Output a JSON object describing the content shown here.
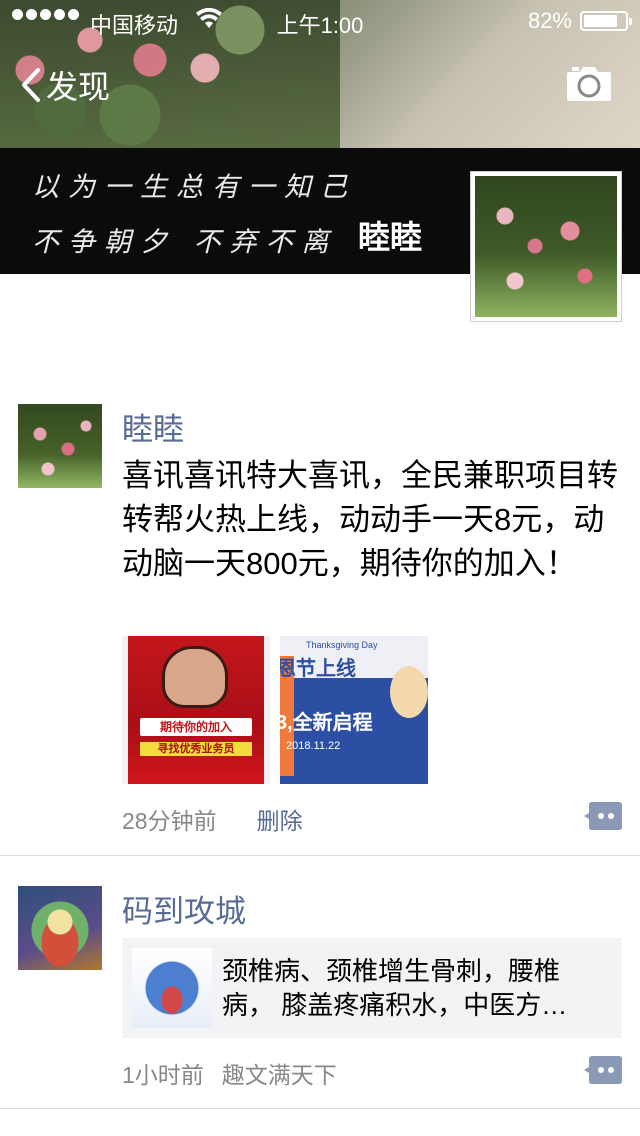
{
  "status_bar": {
    "carrier": "中国移动",
    "time": "上午1:00",
    "battery_pct": "82%",
    "battery_level": 0.82
  },
  "nav": {
    "back_label": "发现",
    "back_icon": "chevron-left-icon",
    "camera_icon": "camera-icon"
  },
  "cover": {
    "poem_line1": "以为一生总有一知己",
    "poem_line2": "不争朝夕 不弃不离",
    "user_name": "睦睦"
  },
  "posts": [
    {
      "name": "睦睦",
      "text": "喜讯喜讯特大喜讯，全民兼职项目转转帮火热上线，动动手一天8元，动动脑一天800元，期待你的加入！",
      "images": [
        {
          "lines": [
            "期待你的加入",
            "寻找优秀业务员"
          ]
        },
        {
          "lines": [
            "Thanksgiving Day",
            "恩节上线",
            "3,全新启程",
            "2018.11.22"
          ]
        }
      ],
      "time": "28分钟前",
      "delete_label": "删除"
    },
    {
      "name": "码到攻城",
      "link_text": "颈椎病、颈椎增生骨刺，腰椎病， 膝盖疼痛积水，中医方…",
      "time": "1小时前",
      "source": "趣文满天下"
    }
  ]
}
